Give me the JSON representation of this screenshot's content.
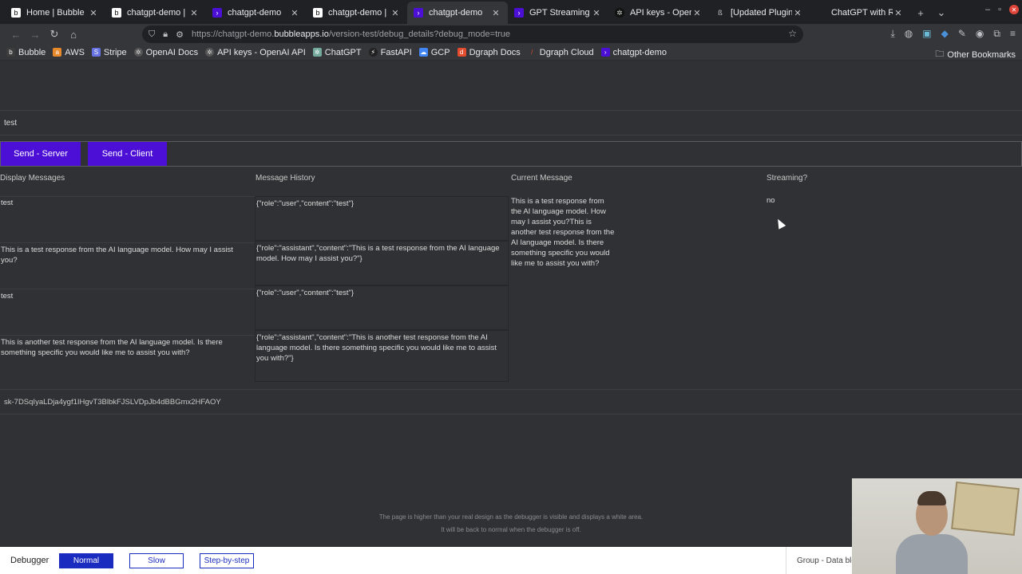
{
  "browser": {
    "tabs": [
      {
        "title": "Home | Bubble",
        "icon": "bubble-b-icon",
        "active": false
      },
      {
        "title": "chatgpt-demo | Bub",
        "icon": "bubble-b-icon",
        "active": false
      },
      {
        "title": "chatgpt-demo",
        "icon": "bubble-app-icon",
        "active": false
      },
      {
        "title": "chatgpt-demo | Bub",
        "icon": "bubble-b-icon",
        "active": false
      },
      {
        "title": "chatgpt-demo",
        "icon": "bubble-app-icon",
        "active": true
      },
      {
        "title": "GPT Streaming",
        "icon": "bubble-app-icon",
        "active": false
      },
      {
        "title": "API keys - OpenAI A",
        "icon": "openai-icon",
        "active": false
      },
      {
        "title": "[Updated Plugin] Ch",
        "icon": "forum-icon",
        "active": false
      },
      {
        "title": "ChatGPT with Real-",
        "icon": "bubble-b-icon",
        "active": false
      }
    ],
    "url_prefix": "https://chatgpt-demo.",
    "url_domain": "bubbleapps.io",
    "url_suffix": "/version-test/debug_details?debug_mode=true",
    "bookmarks": [
      {
        "label": "Bubble",
        "icon": "bubble-b-icon",
        "color": "#3d3d3d"
      },
      {
        "label": "AWS",
        "icon": "aws-icon",
        "color": "#e8892c"
      },
      {
        "label": "Stripe",
        "icon": "stripe-icon",
        "color": "#6772e5"
      },
      {
        "label": "OpenAI Docs",
        "icon": "openai-icon",
        "color": "#555555"
      },
      {
        "label": "API keys - OpenAI API",
        "icon": "openai-icon",
        "color": "#555555"
      },
      {
        "label": "ChatGPT",
        "icon": "chatgpt-icon",
        "color": "#74aa9c"
      },
      {
        "label": "FastAPI",
        "icon": "fastapi-icon",
        "color": "#222222"
      },
      {
        "label": "GCP",
        "icon": "gcp-icon",
        "color": "#4285f4"
      },
      {
        "label": "Dgraph Docs",
        "icon": "dgraph-icon",
        "color": "#e24b2b"
      },
      {
        "label": "Dgraph Cloud",
        "icon": "dgraph-cloud-icon",
        "color": "#e24b2b"
      },
      {
        "label": "chatgpt-demo",
        "icon": "bubble-app-icon",
        "color": "#4b0fd6"
      }
    ],
    "other_bookmarks": "Other Bookmarks"
  },
  "page": {
    "input_value": "test",
    "send_server_label": "Send - Server",
    "send_client_label": "Send - Client",
    "headers": {
      "display": "Display Messages",
      "history": "Message History",
      "current": "Current Message",
      "streaming": "Streaming?"
    },
    "display_messages": [
      "test",
      "This is a test response from the AI language model. How may I assist you?",
      "test",
      "This is another test response from the AI language model. Is there something specific you would like me to assist you with?"
    ],
    "message_history": [
      "{\"role\":\"user\",\"content\":\"test\"}",
      "{\"role\":\"assistant\",\"content\":\"This is a test response from the AI language model. How may I assist you?\"}",
      "{\"role\":\"user\",\"content\":\"test\"}",
      "{\"role\":\"assistant\",\"content\":\"This is another test response from the AI language model. Is there something specific you would like me to assist you with?\"}"
    ],
    "current_message": "This is a test response from the AI language model. How may I assist you?This is another test response from the AI language model. Is there something specific you would like me to assist you with?",
    "streaming": "no",
    "api_key": "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",
    "notice_line1": "The page is higher than your real design as the debugger is visible and displays a white area.",
    "notice_line2": "It will be back to normal when the debugger is off."
  },
  "debugger": {
    "label": "Debugger",
    "normal": "Normal",
    "slow": "Slow",
    "step": "Step-by-step",
    "group": "Group - Data blo"
  },
  "colors": {
    "accent_purple": "#4b0fd6",
    "debug_blue": "#1a2bbf",
    "page_bg": "#303134"
  }
}
